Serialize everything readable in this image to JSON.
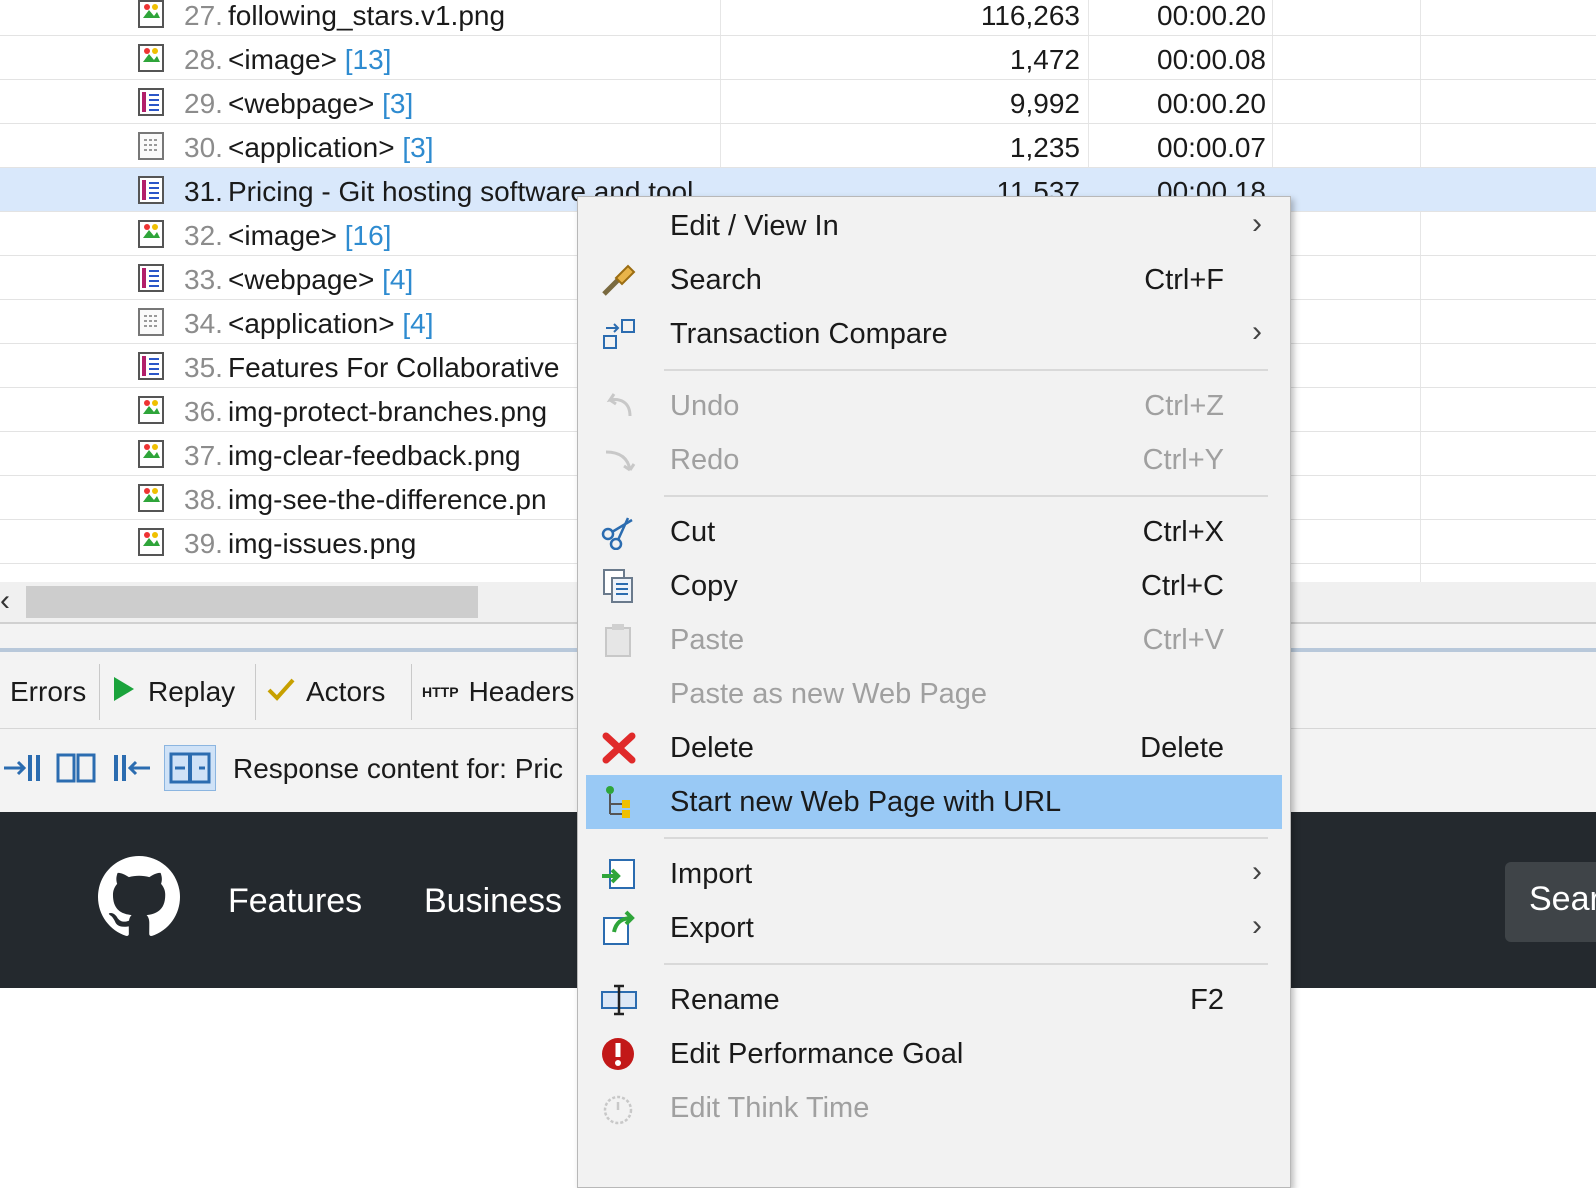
{
  "table": {
    "rows": [
      {
        "num": "27.",
        "name": "following_stars.v1.png",
        "count": "",
        "size": "116,263",
        "time": "00:00.20",
        "icon": "image-icon"
      },
      {
        "num": "28.",
        "name": "<image>",
        "count": "[13]",
        "size": "1,472",
        "time": "00:00.08",
        "icon": "image-icon"
      },
      {
        "num": "29.",
        "name": "<webpage>",
        "count": "[3]",
        "size": "9,992",
        "time": "00:00.20",
        "icon": "webpage-icon"
      },
      {
        "num": "30.",
        "name": "<application>",
        "count": "[3]",
        "size": "1,235",
        "time": "00:00.07",
        "icon": "application-icon"
      },
      {
        "num": "31.",
        "name": "Pricing - Git hosting software and tool",
        "count": "",
        "size": "11,537",
        "time": "00:00.18",
        "icon": "webpage-icon",
        "selected": true
      },
      {
        "num": "32.",
        "name": "<image>",
        "count": "[16]",
        "size": "",
        "time": "",
        "icon": "image-icon"
      },
      {
        "num": "33.",
        "name": "<webpage>",
        "count": "[4]",
        "size": "",
        "time": "",
        "icon": "webpage-icon"
      },
      {
        "num": "34.",
        "name": "<application>",
        "count": "[4]",
        "size": "",
        "time": "",
        "icon": "application-icon"
      },
      {
        "num": "35.",
        "name": "Features For Collaborative",
        "count": "",
        "size": "",
        "time": "",
        "icon": "webpage-icon"
      },
      {
        "num": "36.",
        "name": "img-protect-branches.png",
        "count": "",
        "size": "",
        "time": "",
        "icon": "image-icon"
      },
      {
        "num": "37.",
        "name": "img-clear-feedback.png",
        "count": "",
        "size": "",
        "time": "",
        "icon": "image-icon"
      },
      {
        "num": "38.",
        "name": "img-see-the-difference.pn",
        "count": "",
        "size": "",
        "time": "",
        "icon": "image-icon"
      },
      {
        "num": "39.",
        "name": "img-issues.png",
        "count": "",
        "size": "",
        "time": "",
        "icon": "image-icon"
      }
    ]
  },
  "tabs": [
    {
      "label": "Errors",
      "icon": ""
    },
    {
      "label": "Replay",
      "icon": "play-icon"
    },
    {
      "label": "Actors",
      "icon": "check-icon"
    },
    {
      "label": "Headers",
      "icon": "http-icon",
      "icon_text": "HTTP"
    }
  ],
  "response": {
    "label": "Response content for: Pric"
  },
  "github": {
    "nav": [
      "Features",
      "Business"
    ],
    "search_text": "Sear"
  },
  "menu": {
    "items": [
      {
        "label": "Edit / View In",
        "shortcut": "",
        "submenu": true,
        "icon": "",
        "disabled": false
      },
      {
        "label": "Search",
        "shortcut": "Ctrl+F",
        "submenu": false,
        "icon": "flashlight-icon",
        "disabled": false
      },
      {
        "label": "Transaction Compare",
        "shortcut": "",
        "submenu": true,
        "icon": "compare-icon",
        "disabled": false
      },
      {
        "sep": true
      },
      {
        "label": "Undo",
        "shortcut": "Ctrl+Z",
        "submenu": false,
        "icon": "undo-icon",
        "disabled": true
      },
      {
        "label": "Redo",
        "shortcut": "Ctrl+Y",
        "submenu": false,
        "icon": "redo-icon",
        "disabled": true
      },
      {
        "sep": true
      },
      {
        "label": "Cut",
        "shortcut": "Ctrl+X",
        "submenu": false,
        "icon": "scissors-icon",
        "disabled": false
      },
      {
        "label": "Copy",
        "shortcut": "Ctrl+C",
        "submenu": false,
        "icon": "copy-icon",
        "disabled": false
      },
      {
        "label": "Paste",
        "shortcut": "Ctrl+V",
        "submenu": false,
        "icon": "clipboard-icon",
        "disabled": true
      },
      {
        "label": "Paste as new Web Page",
        "shortcut": "",
        "submenu": false,
        "icon": "",
        "disabled": true
      },
      {
        "label": "Delete",
        "shortcut": "Delete",
        "submenu": false,
        "icon": "delete-icon",
        "disabled": false
      },
      {
        "label": "Start new Web Page with URL",
        "shortcut": "",
        "submenu": false,
        "icon": "tree-icon",
        "disabled": false,
        "highlighted": true
      },
      {
        "sep": true
      },
      {
        "label": "Import",
        "shortcut": "",
        "submenu": true,
        "icon": "import-icon",
        "disabled": false
      },
      {
        "label": "Export",
        "shortcut": "",
        "submenu": true,
        "icon": "export-icon",
        "disabled": false
      },
      {
        "sep": true
      },
      {
        "label": "Rename",
        "shortcut": "F2",
        "submenu": false,
        "icon": "rename-icon",
        "disabled": false
      },
      {
        "label": "Edit Performance Goal",
        "shortcut": "",
        "submenu": false,
        "icon": "alert-icon",
        "disabled": false
      },
      {
        "label": "Edit Think Time",
        "shortcut": "",
        "submenu": false,
        "icon": "stopwatch-icon",
        "disabled": true
      }
    ]
  },
  "colors": {
    "selection": "#d9e8fb",
    "menu_highlight": "#99c9f5",
    "count_blue": "#2e8bd0",
    "github_dark": "#24292e"
  }
}
